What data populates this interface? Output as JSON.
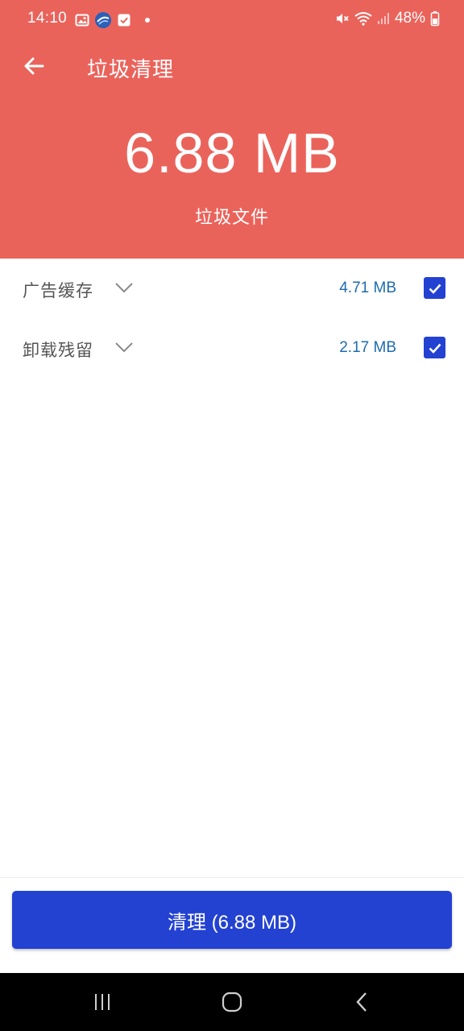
{
  "status_bar": {
    "time": "14:10",
    "battery": "48%",
    "icons_left": [
      "gallery-icon",
      "app-badge-icon",
      "checkbox-notification-icon",
      "dot-icon"
    ],
    "icons_right": [
      "mute-icon",
      "wifi-icon",
      "signal-icon",
      "battery-icon"
    ]
  },
  "app_bar": {
    "title": "垃圾清理",
    "back_icon": "arrow-left-icon"
  },
  "summary": {
    "total_size": "6.88 MB",
    "caption": "垃圾文件"
  },
  "items": [
    {
      "label": "广告缓存",
      "size": "4.71 MB",
      "checked": true
    },
    {
      "label": "卸载残留",
      "size": "2.17 MB",
      "checked": true
    }
  ],
  "clean_button": {
    "label": "清理 (6.88 MB)"
  },
  "colors": {
    "header_bg": "#EA635B",
    "accent_blue": "#2342D2",
    "size_text": "#1E6BAE"
  }
}
